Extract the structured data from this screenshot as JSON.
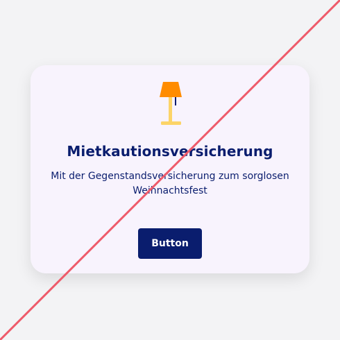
{
  "card": {
    "icon": "floor-lamp-icon",
    "title": "Mietkautionsversicherung",
    "subtitle": "Mit der Gegenstandsversicherung zum sorglosen Weihnachtsfest",
    "button_label": "Button"
  },
  "colors": {
    "page_background": "#f3f3f5",
    "card_background": "#f8f3fd",
    "brand_navy": "#0a1d6e",
    "lamp_shade": "#ff8c00",
    "lamp_body": "#fcd468",
    "strike_line": "#ee5a6a"
  }
}
